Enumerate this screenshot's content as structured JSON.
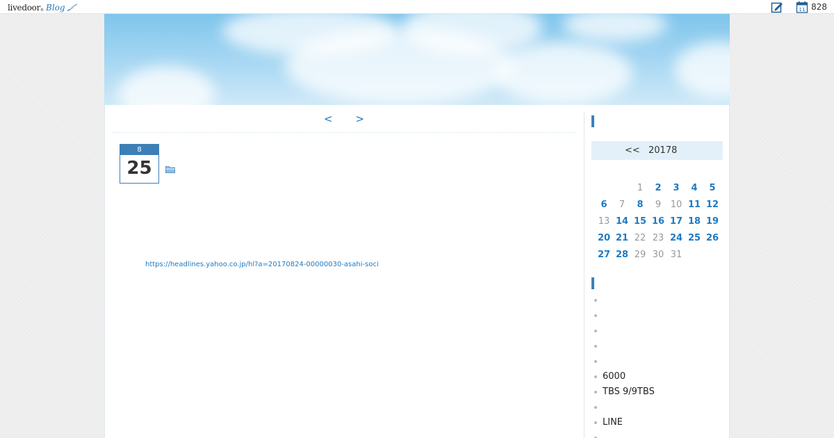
{
  "topbar": {
    "logo_text": "livedoor",
    "logo_tm": "®",
    "logo_blog": "Blog",
    "edit_icon": "edit-icon",
    "calendar_icon": "calendar-icon",
    "calendar_icon_day": "11",
    "count": "828"
  },
  "nav": {
    "prev": "<",
    "next": ">"
  },
  "entry": {
    "month": "8",
    "day": "25",
    "category_icon": "folder-icon",
    "link": "https://headlines.yahoo.co.jp/hl?a=20170824-00000030-asahi-soci"
  },
  "calendar": {
    "prev": "<<",
    "month": "20178",
    "days": [
      {
        "d": "",
        "link": false
      },
      {
        "d": "",
        "link": false
      },
      {
        "d": "1",
        "link": false
      },
      {
        "d": "2",
        "link": true
      },
      {
        "d": "3",
        "link": true
      },
      {
        "d": "4",
        "link": true
      },
      {
        "d": "5",
        "link": true
      },
      {
        "d": "6",
        "link": true
      },
      {
        "d": "7",
        "link": false
      },
      {
        "d": "8",
        "link": true
      },
      {
        "d": "9",
        "link": false
      },
      {
        "d": "10",
        "link": false
      },
      {
        "d": "11",
        "link": true
      },
      {
        "d": "12",
        "link": true
      },
      {
        "d": "13",
        "link": false
      },
      {
        "d": "14",
        "link": true
      },
      {
        "d": "15",
        "link": true
      },
      {
        "d": "16",
        "link": true
      },
      {
        "d": "17",
        "link": true
      },
      {
        "d": "18",
        "link": true
      },
      {
        "d": "19",
        "link": true
      },
      {
        "d": "20",
        "link": true
      },
      {
        "d": "21",
        "link": true
      },
      {
        "d": "22",
        "link": false
      },
      {
        "d": "23",
        "link": false
      },
      {
        "d": "24",
        "link": true
      },
      {
        "d": "25",
        "link": true
      },
      {
        "d": "26",
        "link": true
      },
      {
        "d": "27",
        "link": true
      },
      {
        "d": "28",
        "link": true
      },
      {
        "d": "29",
        "link": false
      },
      {
        "d": "30",
        "link": false
      },
      {
        "d": "31",
        "link": false
      }
    ]
  },
  "recent": [
    "",
    "",
    "",
    "",
    "",
    "6000",
    "TBS 9/9TBS",
    "",
    "LINE",
    ""
  ],
  "colors": {
    "accent": "#3d7fb7",
    "link": "#1f7ac2",
    "calendar_nav_bg": "#e3f0fa"
  }
}
